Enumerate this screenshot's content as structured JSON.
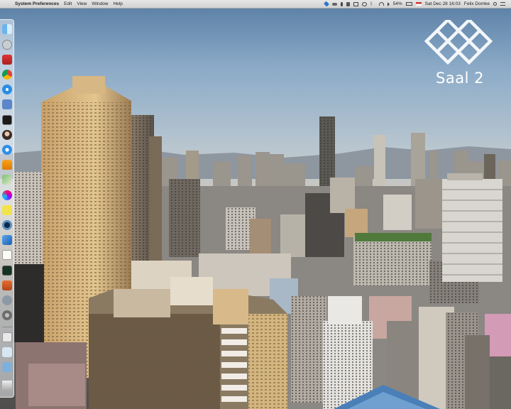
{
  "menubar": {
    "apple_glyph": "",
    "app_name": "System Preferences",
    "menus": [
      "Edit",
      "View",
      "Window",
      "Help"
    ],
    "battery_text": "54%",
    "clock": "Sat Dec 28  16:03",
    "user": "Felix Domke"
  },
  "dock": {
    "icons": [
      "finder-icon",
      "launchpad-icon",
      "photo-booth-icon",
      "chrome-icon",
      "safari-icon",
      "preview-icon",
      "terminal-icon",
      "contacts-avatar-icon",
      "itunes-icon",
      "vlc-icon",
      "maps-icon",
      "color-sync-icon",
      "sticky-icon",
      "time-machine-icon",
      "xcode-icon",
      "textedit-icon",
      "activity-monitor-icon",
      "photo-icon",
      "app-store-icon",
      "system-preferences-icon",
      "documents-stack-icon",
      "downloads-stack-icon",
      "folder-icon",
      "trash-icon"
    ]
  },
  "watermark": {
    "text": "Saal 2",
    "color": "#ffffff"
  }
}
